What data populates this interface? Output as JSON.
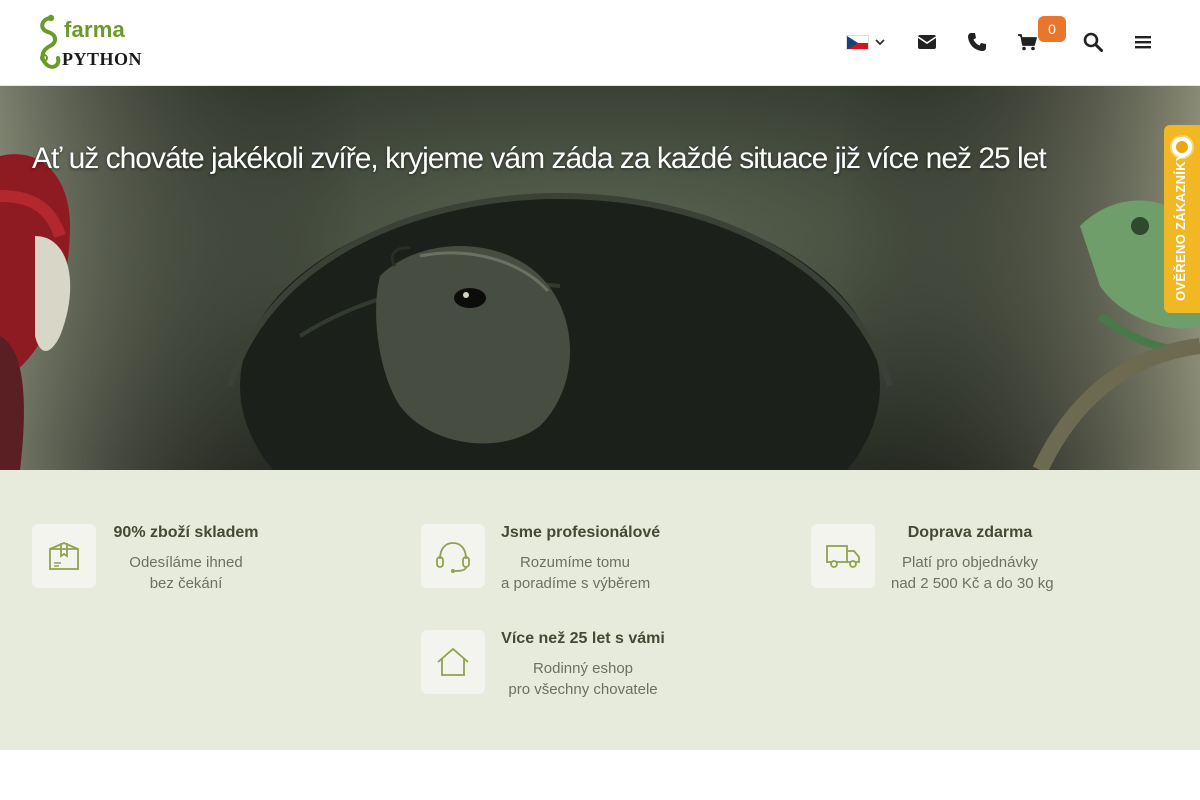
{
  "brand": {
    "farma": "farma",
    "python": "PYTHON",
    "green": "#6a9a2a"
  },
  "header": {
    "language": {
      "selected": "cs",
      "flag": "czech-flag"
    },
    "icons": [
      "envelope-icon",
      "phone-icon",
      "cart-icon",
      "search-icon",
      "menu-icon"
    ],
    "cart_count": "0",
    "accent_color": "#e8762b"
  },
  "hero": {
    "title": "Ať už chováte jakékoli zvíře, kryjeme vám záda za každé situace již více než 25 let"
  },
  "verified_badge": {
    "label": "OVĚŘENO ZÁKAZNÍKY",
    "color": "#f2b824"
  },
  "benefits": [
    {
      "icon": "box-icon",
      "title": "90% zboží skladem",
      "line1": "Odesíláme ihned",
      "line2": "bez čekání"
    },
    {
      "icon": "headset-icon",
      "title": "Jsme profesionálové",
      "line1": "Rozumíme tomu",
      "line2": "a poradíme s výběrem"
    },
    {
      "icon": "truck-icon",
      "title": "Doprava zdarma",
      "line1": "Platí pro objednávky",
      "line2": "nad 2 500 Kč a do 30 kg"
    },
    {
      "icon": "house-icon",
      "title": "Více než 25 let s vámi",
      "line1": "Rodinný eshop",
      "line2": "pro všechny chovatele"
    }
  ]
}
